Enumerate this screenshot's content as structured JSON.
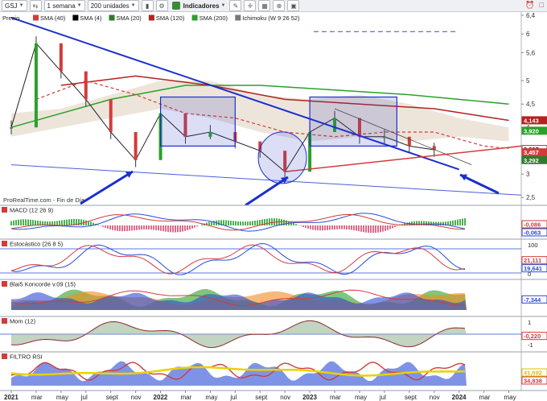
{
  "toolbar": {
    "symbol": "GSJ",
    "timeframe": "1 semana",
    "units": "200 unidades",
    "indicators": "Indicadores"
  },
  "legend": {
    "price": "Precio",
    "items": [
      "SMA (40)",
      "SMA (4)",
      "SMA (20)",
      "SMA (120)",
      "SMA (200)",
      "Ichimoku (W 9 26 52)"
    ],
    "colors": [
      "#d33b3b",
      "#000000",
      "#2f7a2f",
      "#b22222",
      "#2aa12a",
      "#777777"
    ]
  },
  "watermark": "ProRealTime.com - Fin de Día",
  "panels": {
    "macd": "MACD (12 26 9)",
    "stoch": "Estocástico (26 8 5)",
    "blai": "Blai5 Koncorde v.09 (15)",
    "mom": "Mom (12)",
    "rsi": "FILTRO RSI"
  },
  "chart_data": [
    {
      "type": "line",
      "name": "price",
      "x": [
        "2021-01",
        "2021-03",
        "2021-05",
        "2021-07",
        "2021-09",
        "2021-11",
        "2022-01",
        "2022-03",
        "2022-05",
        "2022-07",
        "2022-09",
        "2022-11",
        "2023-01",
        "2023-03",
        "2023-05",
        "2023-07",
        "2023-09",
        "2023-11"
      ],
      "values": [
        4.0,
        5.8,
        5.2,
        4.6,
        3.9,
        3.3,
        4.3,
        3.8,
        3.9,
        3.7,
        3.5,
        3.05,
        3.9,
        4.2,
        3.8,
        3.8,
        3.6,
        3.52
      ],
      "yticks": [
        6.4,
        6,
        5.6,
        5,
        4.5,
        4,
        3.5,
        3,
        2.5
      ],
      "ylim": [
        2.4,
        6.4
      ],
      "xticks": [
        "2021",
        "mar",
        "may",
        "jul",
        "sept",
        "nov",
        "2022",
        "mar",
        "may",
        "jul",
        "sept",
        "nov",
        "2023",
        "mar",
        "may",
        "jul",
        "sept",
        "nov",
        "2024",
        "mar",
        "may"
      ],
      "value_labels": [
        "4,143",
        "3,920",
        "3,527",
        "3,457",
        "3,292"
      ],
      "value_label_colors": [
        "#b22222",
        "#2aa12a",
        "#555555",
        "#d33b3b",
        "#2f7a2f"
      ],
      "last_value_label": "3,527"
    },
    {
      "type": "line",
      "name": "MACD",
      "value_labels": [
        "-0,086",
        "-0,063"
      ],
      "value_label_colors": [
        "#d33b3b",
        "#2a4bd6"
      ]
    },
    {
      "type": "line",
      "name": "Estocástico",
      "yticks": [
        "100",
        "50",
        "0"
      ],
      "value_labels": [
        "21,111",
        "19,641"
      ],
      "value_label_colors": [
        "#d33b3b",
        "#2a4bd6"
      ]
    },
    {
      "type": "area",
      "name": "Blai5 Koncorde",
      "value_labels": [
        "-7,344"
      ],
      "value_label_colors": [
        "#2a4bd6"
      ]
    },
    {
      "type": "line",
      "name": "Mom",
      "yticks": [
        "1",
        "0",
        "-1"
      ],
      "value_labels": [
        "-0,220"
      ],
      "value_label_colors": [
        "#d33b3b"
      ]
    },
    {
      "type": "area",
      "name": "FILTRO RSI",
      "value_labels": [
        "41,692",
        "34,838"
      ],
      "value_label_colors": [
        "#d9c400",
        "#d33b3b"
      ]
    }
  ]
}
